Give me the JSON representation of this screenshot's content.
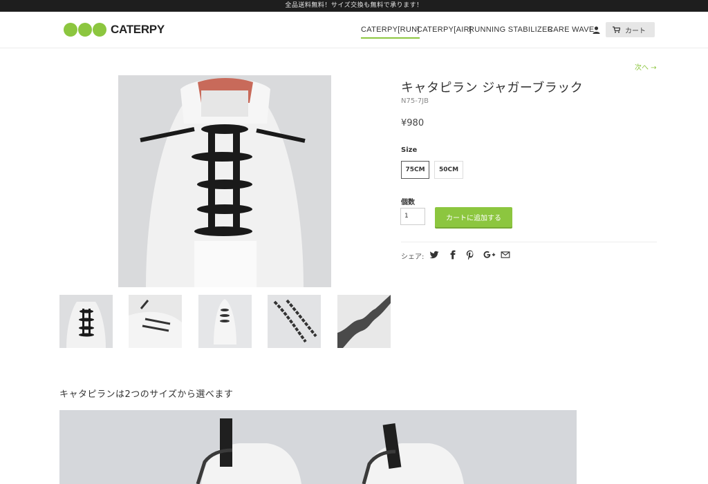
{
  "announcement": "全品送料無料！サイズ交換も無料で承ります！",
  "brand": {
    "name": "CATERPY",
    "color": "#8cc63f"
  },
  "nav": {
    "items": [
      "CATERPY[RUN]",
      "CATERPY[AIR]",
      "RUNNING STABILIZER",
      "CARE WAVE"
    ],
    "active": "CATERPY[RUN]",
    "user_icon": "user-icon",
    "cart_label": "カート",
    "cart_icon": "cart-icon"
  },
  "pager": {
    "next_label": "次へ →"
  },
  "product": {
    "title": "キャタピラン ジャガーブラック",
    "sku": "N75-7JB",
    "price": "¥980",
    "size_label": "Size",
    "sizes": [
      "75CM",
      "50CM"
    ],
    "selected_size": "75CM",
    "qty_label": "個数",
    "qty_value": "1",
    "add_to_cart": "カートに追加する",
    "share_label": "シェア:",
    "share_icons": [
      "twitter-icon",
      "facebook-icon",
      "pinterest-icon",
      "google-plus-icon",
      "mail-icon"
    ]
  },
  "gallery": {
    "thumbnail_count": 5
  },
  "description": {
    "heading": "キャタピランは2つのサイズから選べます"
  },
  "colors": {
    "accent": "#8cc63f",
    "topbar": "#1e1e1e"
  }
}
